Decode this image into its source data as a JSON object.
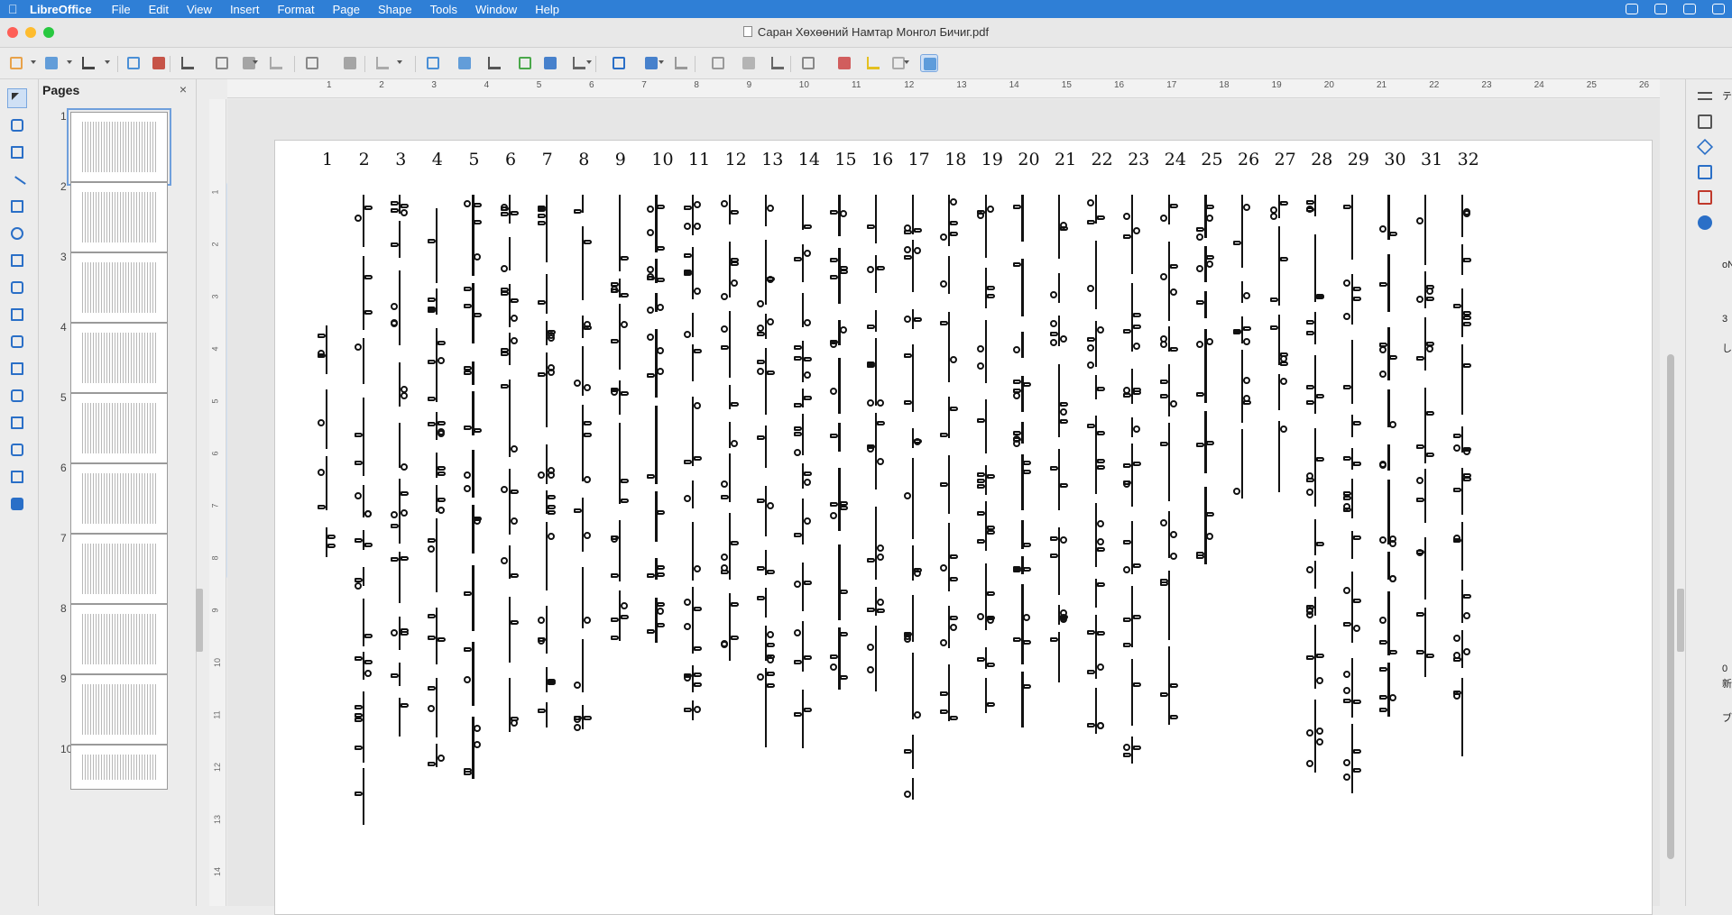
{
  "menubar": {
    "app": "LibreOffice",
    "items": [
      "File",
      "Edit",
      "View",
      "Insert",
      "Format",
      "Page",
      "Shape",
      "Tools",
      "Window",
      "Help"
    ]
  },
  "window": {
    "title": "Саран Хөхөөний Намтар Монгол Бичиг.pdf"
  },
  "colors": {
    "menubar": "#2f7fd6",
    "close": "#fe5f57",
    "minimize": "#febc2e",
    "zoom": "#28c840",
    "selection": "#cfe0f5"
  },
  "pages_panel": {
    "title": "Pages",
    "close": "×",
    "thumbs": [
      "1",
      "2",
      "3",
      "4",
      "5",
      "6",
      "7",
      "8",
      "9",
      "10"
    ],
    "current": "1"
  },
  "ruler": {
    "h_ticks": [
      "1",
      "2",
      "3",
      "4",
      "5",
      "6",
      "7",
      "8",
      "9",
      "10",
      "11",
      "12",
      "13",
      "14",
      "15",
      "16",
      "17",
      "18",
      "19",
      "20",
      "21",
      "22",
      "23",
      "24",
      "25",
      "26"
    ],
    "v_ticks": [
      "1",
      "2",
      "3",
      "4",
      "5",
      "6",
      "7",
      "8",
      "9",
      "10",
      "11",
      "12",
      "13",
      "14"
    ]
  },
  "document": {
    "column_numbers": [
      "1",
      "2",
      "3",
      "4",
      "5",
      "6",
      "7",
      "8",
      "9",
      "10",
      "11",
      "12",
      "13",
      "14",
      "15",
      "16",
      "17",
      "18",
      "19",
      "20",
      "21",
      "22",
      "23",
      "24",
      "25",
      "26",
      "27",
      "28",
      "29",
      "30",
      "31",
      "32"
    ]
  },
  "sidebar_clipped": [
    "テキ",
    "oN",
    "3",
    "し",
    "0",
    "新規",
    "ブ"
  ],
  "icons": {
    "toolbar": [
      "new-doc-icon",
      "open-folder-icon",
      "save-icon",
      "export-icon",
      "export-pdf-icon",
      "print-icon",
      "cut-icon",
      "copy-icon",
      "paste-icon",
      "clone-format-icon",
      "undo-icon",
      "redo-icon",
      "grid-icon",
      "helplines-icon",
      "zoom-icon",
      "image-icon",
      "textbox-icon",
      "special-char-icon",
      "fontwork-icon",
      "transform-icon",
      "align-icon",
      "arrange-icon",
      "distribute-icon",
      "shadow-icon",
      "crop-icon",
      "points-icon",
      "glue-icon",
      "toggle-extrusion-icon",
      "pen-icon"
    ],
    "left": [
      "select-icon",
      "line-color-icon",
      "fill-color-icon",
      "line-icon",
      "rectangle-icon",
      "ellipse-icon",
      "arrow-icon",
      "curve-icon",
      "connector-icon",
      "basic-shapes-icon",
      "symbol-shapes-icon",
      "block-arrows-icon",
      "flowchart-icon",
      "callout-icon",
      "stars-icon",
      "3d-objects-icon"
    ],
    "sidebar": [
      "menu-icon",
      "properties-icon",
      "styles-icon",
      "gallery-icon",
      "navigator-icon",
      "shapes-icon"
    ]
  }
}
